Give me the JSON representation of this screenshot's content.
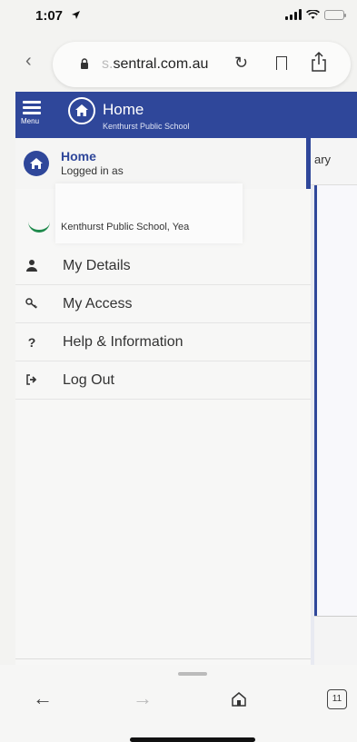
{
  "status": {
    "time": "1:07"
  },
  "browser": {
    "url_faded": "s.",
    "url_main": "sentral.com.au",
    "tab_count": "11"
  },
  "header": {
    "menu_label": "Menu",
    "title": "Home",
    "subtitle": "Kenthurst Public School"
  },
  "page": {
    "partial_label": "ary"
  },
  "drawer": {
    "home_title": "Home",
    "home_sub": "Logged in as",
    "school_text": "Kenthurst Public School, Yea",
    "items": [
      {
        "label": "My Details",
        "icon": "person-icon"
      },
      {
        "label": "My Access",
        "icon": "key-icon"
      },
      {
        "label": "Help & Information",
        "icon": "question-icon"
      },
      {
        "label": "Log Out",
        "icon": "logout-icon"
      }
    ]
  },
  "colors": {
    "brand": "#2f479a",
    "school_green": "#1f8a4c"
  }
}
